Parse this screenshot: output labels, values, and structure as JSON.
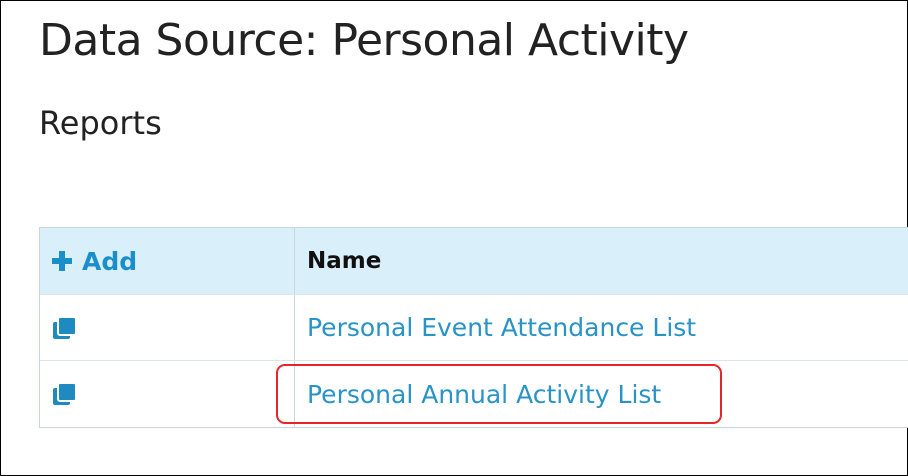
{
  "page": {
    "title": "Data Source: Personal Activity",
    "section_title": "Reports"
  },
  "table": {
    "add_label": "Add",
    "name_header": "Name",
    "rows": [
      {
        "name": "Personal Event Attendance List",
        "icon": "copy-icon",
        "highlighted": false
      },
      {
        "name": "Personal Annual Activity List",
        "icon": "copy-icon",
        "highlighted": true
      }
    ]
  },
  "colors": {
    "link": "#2a93c6",
    "accent": "#1a8fc9",
    "header_bg": "#d9effa",
    "highlight": "#e5252a"
  }
}
